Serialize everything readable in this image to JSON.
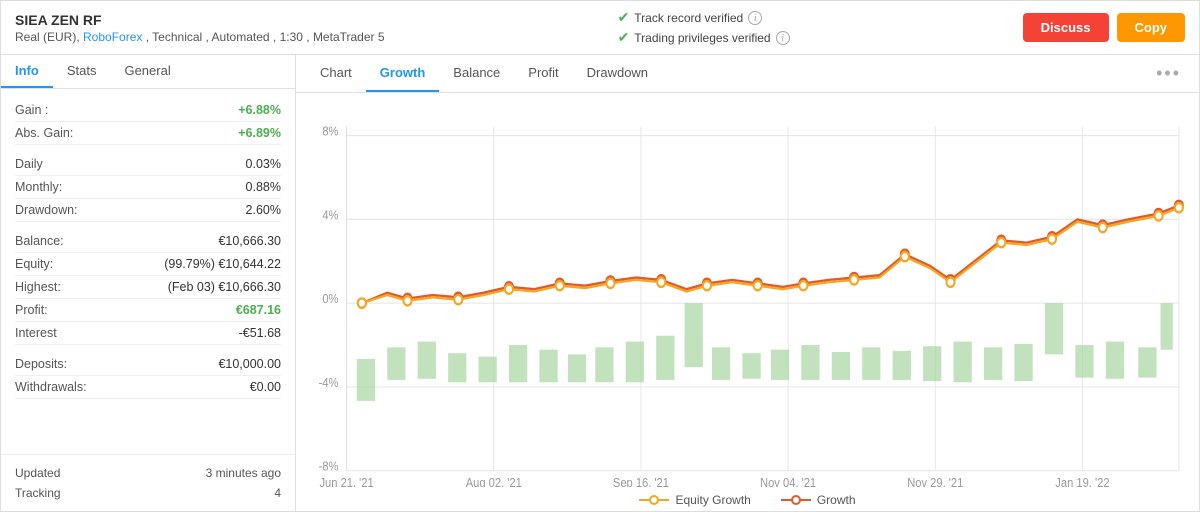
{
  "header": {
    "title": "SIEA ZEN RF",
    "subtitle": "Real (EUR), RoboForex , Technical , Automated , 1:30 , MetaTrader 5",
    "broker_link": "RoboForex",
    "verify1": "Track record verified",
    "verify2": "Trading privileges verified",
    "btn_discuss": "Discuss",
    "btn_copy": "Copy"
  },
  "left_tabs": [
    {
      "label": "Info",
      "active": true
    },
    {
      "label": "Stats",
      "active": false
    },
    {
      "label": "General",
      "active": false
    }
  ],
  "info_rows": [
    {
      "label": "Gain :",
      "value": "+6.88%",
      "class": "green"
    },
    {
      "label": "Abs. Gain:",
      "value": "+6.89%",
      "class": "green"
    },
    {
      "spacer": true
    },
    {
      "label": "Daily",
      "value": "0.03%",
      "class": ""
    },
    {
      "label": "Monthly:",
      "value": "0.88%",
      "class": ""
    },
    {
      "label": "Drawdown:",
      "value": "2.60%",
      "class": ""
    },
    {
      "spacer": true
    },
    {
      "label": "Balance:",
      "value": "€10,666.30",
      "class": ""
    },
    {
      "label": "Equity:",
      "value": "(99.79%) €10,644.22",
      "class": ""
    },
    {
      "label": "Highest:",
      "value": "(Feb 03) €10,666.30",
      "class": ""
    },
    {
      "label": "Profit:",
      "value": "€687.16",
      "class": "green"
    },
    {
      "label": "Interest",
      "value": "-€51.68",
      "class": ""
    },
    {
      "spacer": true
    },
    {
      "label": "Deposits:",
      "value": "€10,000.00",
      "class": ""
    },
    {
      "label": "Withdrawals:",
      "value": "€0.00",
      "class": ""
    }
  ],
  "footer": {
    "updated_label": "Updated",
    "updated_value": "3 minutes ago",
    "tracking_label": "Tracking",
    "tracking_value": "4"
  },
  "chart_tabs": [
    {
      "label": "Chart",
      "active": false
    },
    {
      "label": "Growth",
      "active": true
    },
    {
      "label": "Balance",
      "active": false
    },
    {
      "label": "Profit",
      "active": false
    },
    {
      "label": "Drawdown",
      "active": false
    }
  ],
  "chart": {
    "x_labels": [
      "Jun 21, '21",
      "Aug 02, '21",
      "Sep 16, '21",
      "Nov 04, '21",
      "Nov 29, '21",
      "Jan 19, '22"
    ],
    "y_labels": [
      "8%",
      "4%",
      "0%",
      "-4%",
      "-8%"
    ],
    "legend": {
      "equity_growth": "Equity Growth",
      "growth": "Growth",
      "equity_color": "#f5a623",
      "growth_color": "#e05a2b"
    }
  },
  "more_icon": "•••"
}
